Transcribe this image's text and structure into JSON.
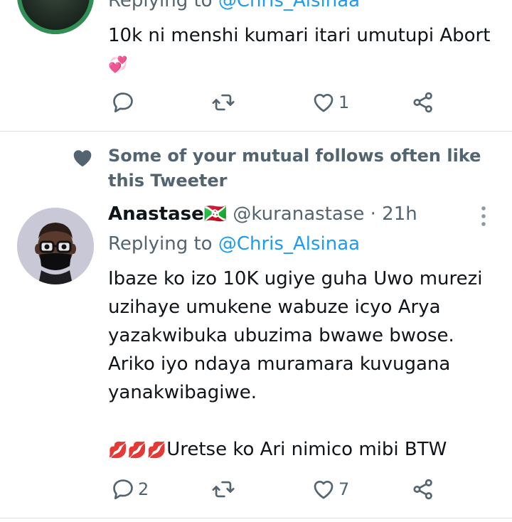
{
  "tweet1": {
    "reply_prefix": "Replying to ",
    "reply_handle": "@Chris_Alsinaa",
    "text": "10k ni menshi kumari itari umutupi Abort",
    "emoji": "💞",
    "actions": {
      "reply_count": "",
      "retweet_count": "",
      "like_count": "1"
    }
  },
  "social_context": "Some of your mutual follows often like this Tweeter",
  "tweet2": {
    "display_name": "Anastase🇧🇮",
    "handle": "@kuranastase",
    "separator": " · ",
    "time": "21h",
    "reply_prefix": "Replying to ",
    "reply_handle": "@Chris_Alsinaa",
    "text": "Ibaze ko izo 10K ugiye guha Uwo murezi uzihaye umukene wabuze icyo Arya yazakwibuka ubuzima bwawe bwose. Ariko iyo ndaya muramara kuvugana yanakwibagiwe.",
    "emojis": "💋💋💋",
    "text_after": "Uretse ko Ari nimico mibi BTW",
    "actions": {
      "reply_count": "2",
      "retweet_count": "",
      "like_count": "7"
    }
  },
  "icons": {
    "reply": "reply-icon",
    "retweet": "retweet-icon",
    "like": "heart-icon",
    "share": "share-icon",
    "more": "more-vertical-icon",
    "social": "heart-filled-icon"
  },
  "colors": {
    "link": "#1d9bf0",
    "secondary": "#536471",
    "text": "#0f1419"
  }
}
